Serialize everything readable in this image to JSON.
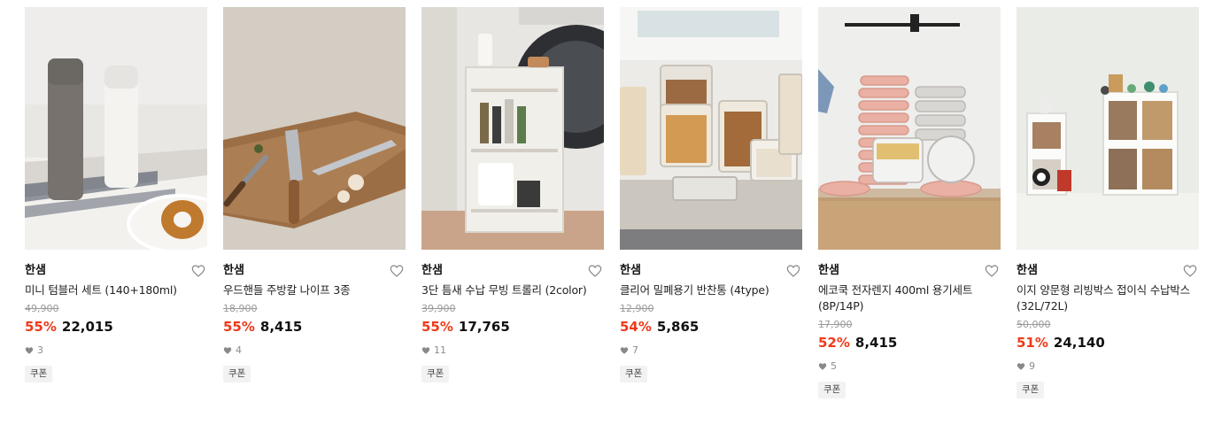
{
  "products": [
    {
      "brand": "한샘",
      "title": "미니 텀블러 세트 (140+180ml)",
      "original_price": "49,900",
      "discount": "55%",
      "price": "22,015",
      "likes": "3",
      "badge": "쿠폰",
      "image": "tumbler-set-photo"
    },
    {
      "brand": "한샘",
      "title": "우드핸들 주방칼 나이프 3종",
      "original_price": "18,900",
      "discount": "55%",
      "price": "8,415",
      "likes": "4",
      "badge": "쿠폰",
      "image": "kitchen-knife-photo"
    },
    {
      "brand": "한샘",
      "title": "3단 틈새 수납 무빙 트롤리 (2color)",
      "original_price": "39,900",
      "discount": "55%",
      "price": "17,765",
      "likes": "11",
      "badge": "쿠폰",
      "image": "storage-trolley-photo"
    },
    {
      "brand": "한샘",
      "title": "클리어 밀폐용기 반찬통 (4type)",
      "original_price": "12,900",
      "discount": "54%",
      "price": "5,865",
      "likes": "7",
      "badge": "쿠폰",
      "image": "clear-container-photo"
    },
    {
      "brand": "한샘",
      "title": "에코쿡 전자렌지 400ml 용기세트 (8P/14P)",
      "original_price": "17,900",
      "discount": "52%",
      "price": "8,415",
      "likes": "5",
      "badge": "쿠폰",
      "image": "microwave-container-photo"
    },
    {
      "brand": "한샘",
      "title": "이지 양문형 리빙박스 접이식 수납박스 (32L/72L)",
      "original_price": "50,000",
      "discount": "51%",
      "price": "24,140",
      "likes": "9",
      "badge": "쿠폰",
      "image": "living-box-photo"
    }
  ],
  "colors": {
    "discount": "#ee3a1a",
    "price": "#111111",
    "muted": "#9a9a9a",
    "badge_bg": "#f2f2f2"
  },
  "icons": {
    "wishlist": "heart-outline-icon",
    "likes": "heart-filled-icon"
  }
}
